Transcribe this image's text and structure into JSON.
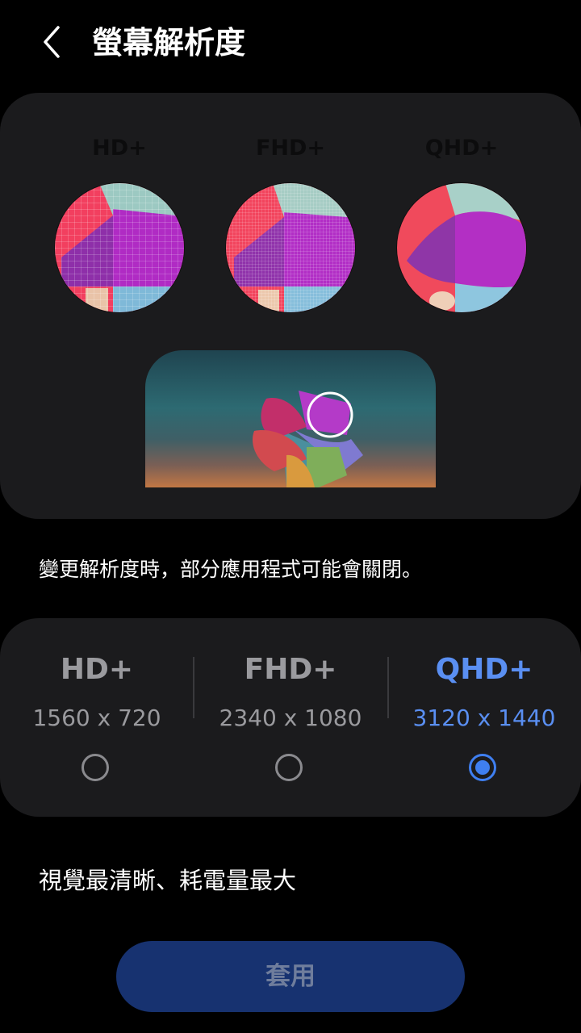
{
  "header": {
    "title": "螢幕解析度",
    "back_icon": "chevron-left-icon"
  },
  "preview": {
    "labels": [
      "HD+",
      "FHD+",
      "QHD+"
    ],
    "label_color": "#0c0c0d",
    "magnifier_icon": "magnifier-circle-icon"
  },
  "notice": "變更解析度時，部分應用程式可能會關閉。",
  "options": [
    {
      "name": "HD+",
      "resolution": "1560 x 720",
      "selected": false
    },
    {
      "name": "FHD+",
      "resolution": "2340 x 1080",
      "selected": false
    },
    {
      "name": "QHD+",
      "resolution": "3120 x 1440",
      "selected": true
    }
  ],
  "description": "視覺最清晰、耗電量最大",
  "apply_button": {
    "label": "套用",
    "enabled": false
  },
  "colors": {
    "background": "#000000",
    "card": "#1b1b1d",
    "accent": "#3f7ff0",
    "selected_text": "#5a8ff2",
    "muted_text": "#9a9a9e",
    "button_bg": "#173270",
    "button_text": "#6f7d9c"
  }
}
